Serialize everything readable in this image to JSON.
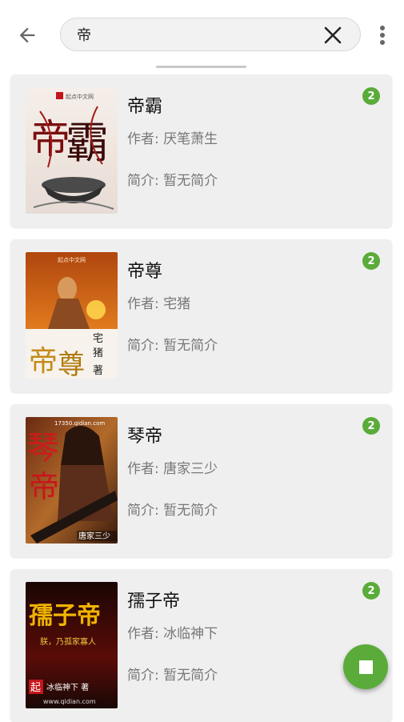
{
  "search": {
    "query": "帝"
  },
  "icons": {
    "back": "arrow-left-icon",
    "clear": "close-icon",
    "more": "more-vert-icon",
    "stop": "stop-icon"
  },
  "colors": {
    "accent": "#5aab3a",
    "card_bg": "#efefef"
  },
  "results": [
    {
      "title": "帝霸",
      "author": "作者: 厌笔萧生",
      "intro": "简介: 暂无简介",
      "badge": "2",
      "cover_text": [
        "起点中文网",
        "帝",
        "霸"
      ]
    },
    {
      "title": "帝尊",
      "author": "作者: 宅猪",
      "intro": "简介: 暂无简介",
      "badge": "2",
      "cover_text": [
        "起点中文网",
        "帝",
        "尊",
        "宅",
        "猪",
        "著"
      ]
    },
    {
      "title": "琴帝",
      "author": "作者: 唐家三少",
      "intro": "简介: 暂无简介",
      "badge": "2",
      "cover_text": [
        "17350.qidian.com",
        "琴",
        "帝",
        "唐家三少"
      ]
    },
    {
      "title": "孺子帝",
      "author": "作者: 冰临神下",
      "intro": "简介: 暂无简介",
      "badge": "2",
      "cover_text": [
        "孺子帝",
        "朕，乃孤家寡人",
        "起",
        "冰临神下 著",
        "www.qidian.com"
      ]
    }
  ]
}
